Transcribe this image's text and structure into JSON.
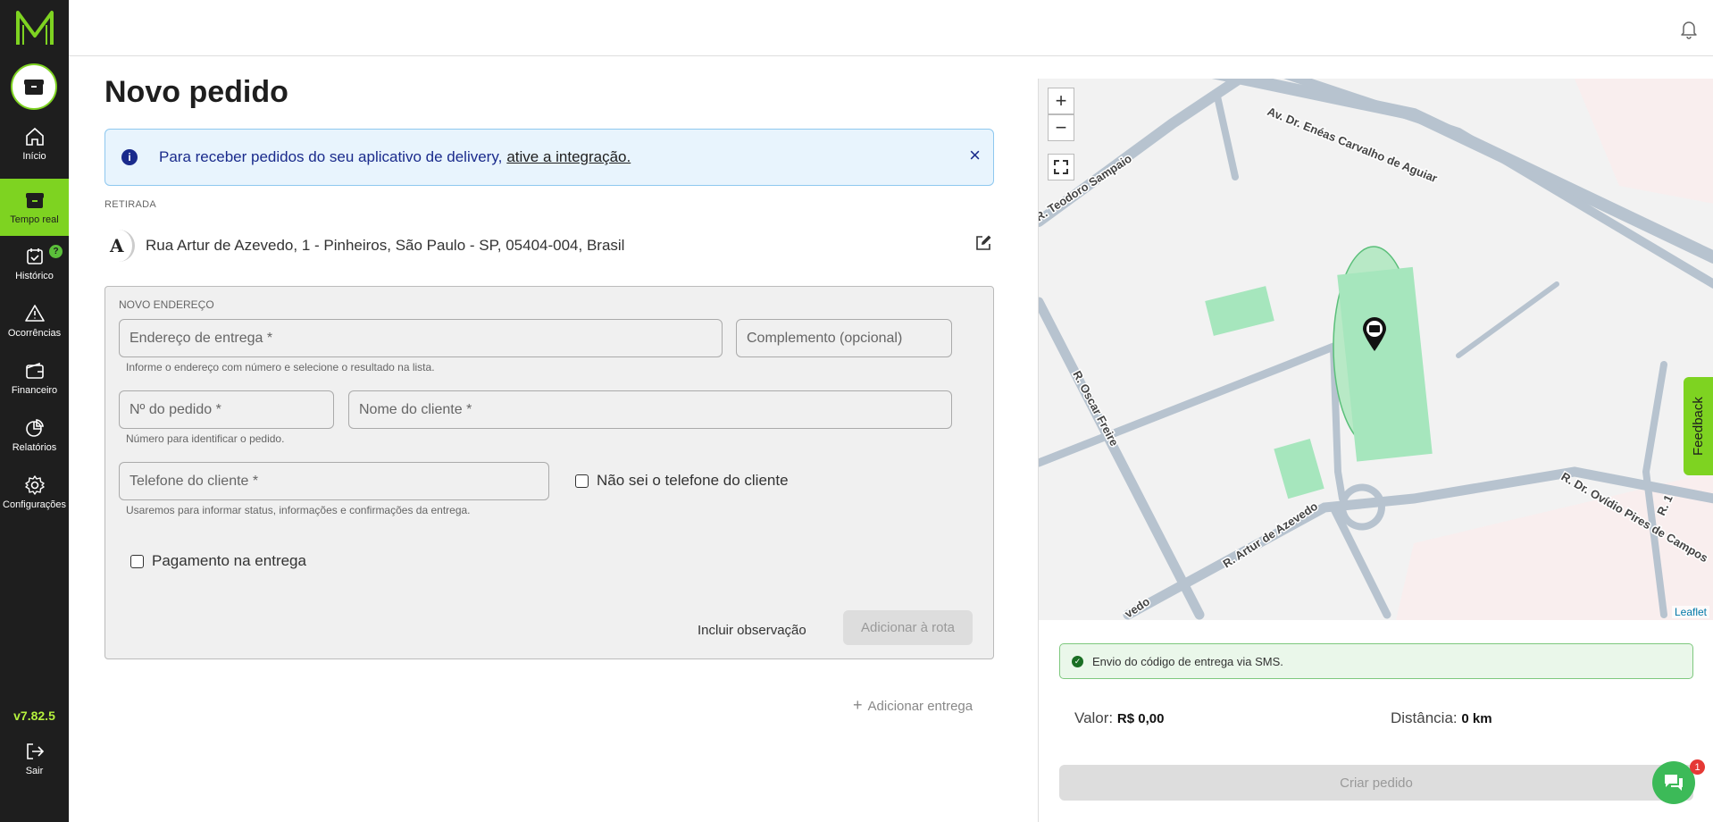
{
  "sidebar": {
    "items": [
      {
        "label": "Início",
        "icon": "home-icon"
      },
      {
        "label": "Tempo real",
        "icon": "box-icon"
      },
      {
        "label": "Histórico",
        "icon": "calendar-check-icon",
        "badge": "?"
      },
      {
        "label": "Ocorrências",
        "icon": "warning-icon"
      },
      {
        "label": "Financeiro",
        "icon": "wallet-icon"
      },
      {
        "label": "Relatórios",
        "icon": "pie-chart-icon"
      },
      {
        "label": "Configurações",
        "icon": "gear-icon"
      }
    ],
    "version": "v7.82.5",
    "logout_label": "Sair",
    "accent_color": "#7ed321"
  },
  "page": {
    "title": "Novo pedido"
  },
  "info_banner": {
    "text": "Para receber pedidos do seu aplicativo de delivery,",
    "link": "ative a integração.",
    "close": "×"
  },
  "pickup": {
    "section_label": "RETIRADA",
    "marker": "A",
    "address": "Rua Artur de Azevedo, 1 - Pinheiros, São Paulo - SP, 05404-004, Brasil"
  },
  "new_address": {
    "title": "NOVO ENDEREÇO",
    "delivery_address_placeholder": "Endereço de entrega *",
    "delivery_address_hint": "Informe o endereço com número e selecione o resultado na lista.",
    "complement_placeholder": "Complemento (opcional)",
    "order_number_placeholder": "Nº do pedido *",
    "order_number_hint": "Número para identificar o pedido.",
    "client_name_placeholder": "Nome do cliente *",
    "client_phone_placeholder": "Telefone do cliente *",
    "client_phone_hint": "Usaremos para informar status, informações e confirmações da entrega.",
    "unknown_phone_label": "Não sei o telefone do cliente",
    "payment_on_delivery_label": "Pagamento na entrega",
    "add_note_label": "Incluir observação",
    "add_to_route_label": "Adicionar à rota"
  },
  "add_delivery_label": "Adicionar entrega",
  "map": {
    "zoom_in": "+",
    "zoom_out": "−",
    "attribution": "Leaflet",
    "streets": [
      "Av. Dr. Enéas Carvalho de Aguiar",
      "R. Teodoro Sampaio",
      "R. Oscar Freire",
      "R. Artur de Azevedo",
      "R. Dr. Ovídio Pires de Campos",
      "R. 1",
      "vedo"
    ]
  },
  "feedback_label": "Feedback",
  "summary": {
    "sms_notice": "Envio do código de entrega via SMS.",
    "value_label": "Valor:",
    "value": "R$ 0,00",
    "distance_label": "Distância:",
    "distance": "0 km",
    "create_order_label": "Criar pedido"
  },
  "chat": {
    "unread": "1"
  }
}
